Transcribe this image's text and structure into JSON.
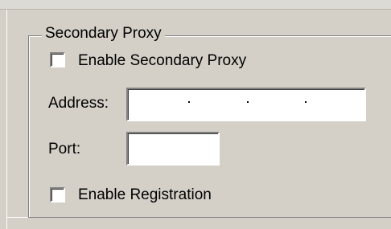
{
  "group": {
    "title": "Secondary Proxy",
    "enable_secondary_proxy": {
      "label": "Enable Secondary Proxy",
      "checked": false
    },
    "address": {
      "label": "Address:",
      "value": ""
    },
    "port": {
      "label": "Port:",
      "value": ""
    },
    "enable_registration": {
      "label": "Enable Registration",
      "checked": false
    }
  }
}
